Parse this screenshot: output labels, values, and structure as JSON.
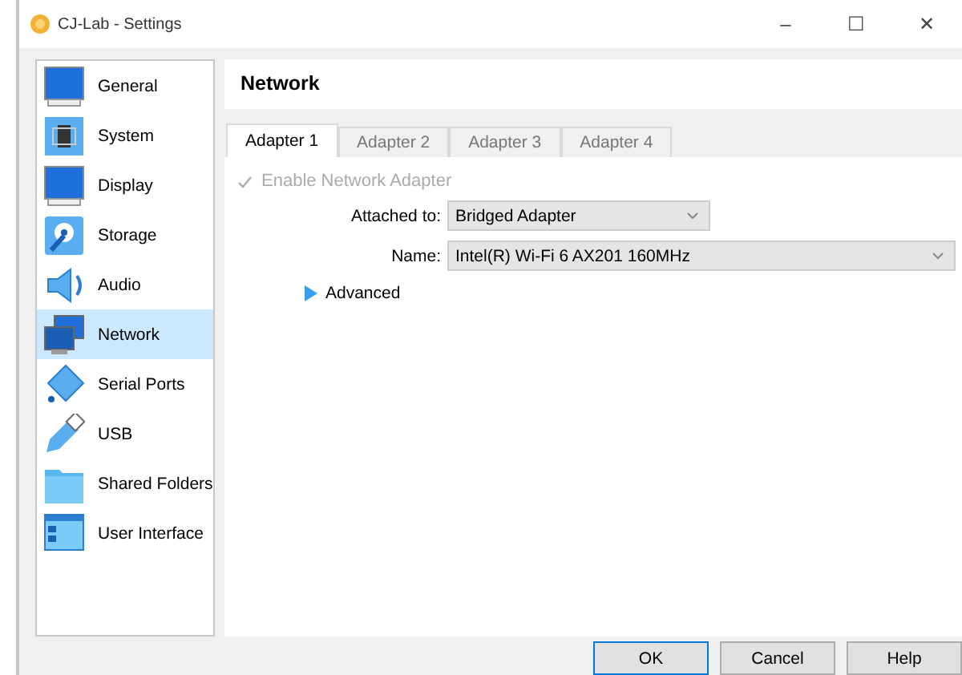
{
  "window": {
    "title": "CJ-Lab - Settings",
    "controls": [
      "–",
      "☐",
      "✕"
    ]
  },
  "sidebar": {
    "items": [
      {
        "label": "General",
        "selected": false
      },
      {
        "label": "System",
        "selected": false
      },
      {
        "label": "Display",
        "selected": false
      },
      {
        "label": "Storage",
        "selected": false
      },
      {
        "label": "Audio",
        "selected": false
      },
      {
        "label": "Network",
        "selected": true
      },
      {
        "label": "Serial Ports",
        "selected": false
      },
      {
        "label": "USB",
        "selected": false
      },
      {
        "label": "Shared Folders",
        "selected": false
      },
      {
        "label": "User Interface",
        "selected": false
      }
    ]
  },
  "page": {
    "title": "Network"
  },
  "tabs": [
    {
      "label": "Adapter 1",
      "selected": true
    },
    {
      "label": "Adapter 2",
      "selected": false
    },
    {
      "label": "Adapter 3",
      "selected": false
    },
    {
      "label": "Adapter 4",
      "selected": false
    }
  ],
  "enable": {
    "label": "Enable Network Adapter",
    "checked": true,
    "disabled": true
  },
  "fields": [
    {
      "label": "Attached to:",
      "value": "Bridged Adapter",
      "wide": false
    },
    {
      "label": "Name:",
      "value": "Intel(R) Wi-Fi 6 AX201 160MHz",
      "wide": true
    }
  ],
  "advanced": {
    "label": "Advanced",
    "expanded": false
  },
  "buttons": [
    {
      "label": "OK",
      "default": true
    },
    {
      "label": "Cancel",
      "default": false
    },
    {
      "label": "Help",
      "default": false
    }
  ]
}
